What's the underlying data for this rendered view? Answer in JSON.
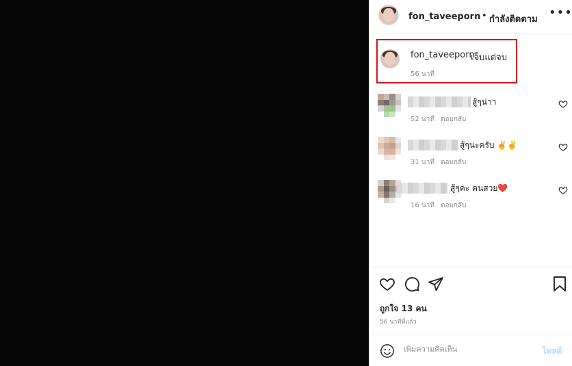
{
  "post": {
    "username": "fon_taveeporn",
    "separator": "•",
    "follow_status": "กำลังติดตาม",
    "more_label": "•••"
  },
  "caption": {
    "username": "fon_taveeporn",
    "text": "เจ็บแต่จบ",
    "time": "56 นาที"
  },
  "comments": [
    {
      "text": "สู้ๆน่าา",
      "time": "52 นาที",
      "reply": "ตอบกลับ"
    },
    {
      "text": "สู้ๆนะครับ ✌️✌️",
      "time": "31 นาที",
      "reply": "ตอบกลับ"
    },
    {
      "text": "สู้ๆคะ คนสวย❤️",
      "time": "16 นาที",
      "reply": "ตอบกลับ"
    }
  ],
  "likes_label": "ถูกใจ 13 คน",
  "posted_time": "56 นาทีที่แล้ว",
  "comment_box": {
    "placeholder": "เพิ่มความคิดเห็น",
    "post_label": "โพสต์"
  },
  "colors": {
    "highlight_border": "#d3151c",
    "post_button": "#b2dffc",
    "secondary_text": "#8e8e8e"
  }
}
